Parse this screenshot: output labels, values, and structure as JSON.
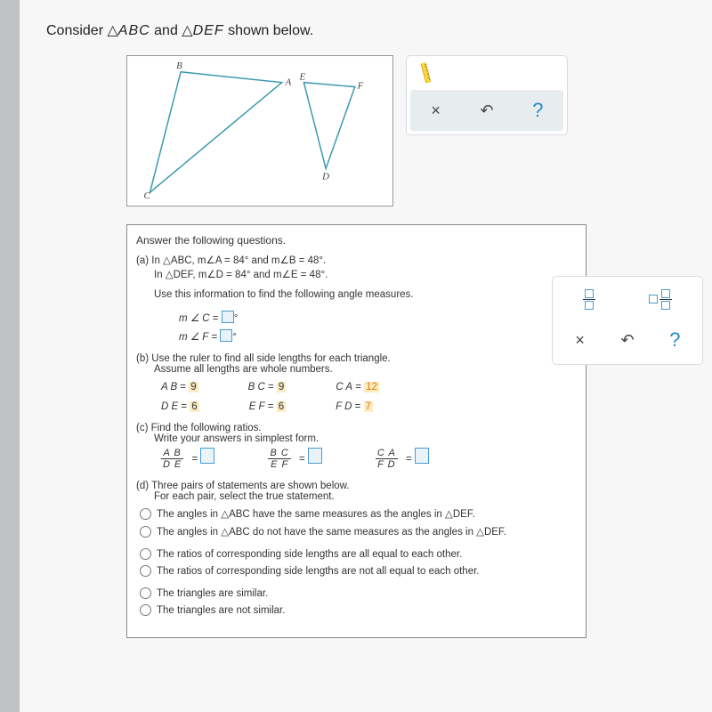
{
  "prompt": {
    "prefix": "Consider ",
    "tri1": "ABC",
    "mid": " and ",
    "tri2": "DEF",
    "suffix": " shown below."
  },
  "answers": {
    "heading": "Answer the following questions.",
    "a": {
      "label": "(a)",
      "line1": " In △ABC, m∠A = 84° and m∠B = 48°.",
      "line2": "In △DEF, m∠D = 84° and m∠E = 48°.",
      "instr": "Use this information to find the following angle measures.",
      "mc": "m ∠ C",
      "mf": "m ∠ F"
    },
    "b": {
      "label": "(b)",
      "text": "Use the ruler to find all side lengths for each triangle.",
      "sub": "Assume all lengths are whole numbers.",
      "ab": {
        "l": "A B",
        "v": "9"
      },
      "bc": {
        "l": "B C",
        "v": "9"
      },
      "ca": {
        "l": "C A",
        "v": "12"
      },
      "de": {
        "l": "D E",
        "v": "6"
      },
      "ef": {
        "l": "E F",
        "v": "6"
      },
      "fd": {
        "l": "F D",
        "v": "7"
      }
    },
    "c": {
      "label": "(c)",
      "text": "Find the following ratios.",
      "sub": "Write your answers in simplest form.",
      "r1": {
        "n": "A B",
        "d": "D E"
      },
      "r2": {
        "n": "B C",
        "d": "E F"
      },
      "r3": {
        "n": "C A",
        "d": "F D"
      }
    },
    "d": {
      "label": "(d)",
      "text": "Three pairs of statements are shown below.",
      "sub": "For each pair, select the true statement.",
      "p1a": "The angles in △ABC have the same measures as the angles in △DEF.",
      "p1b": "The angles in △ABC do not have the same measures as the angles in △DEF.",
      "p2a": "The ratios of corresponding side lengths are all equal to each other.",
      "p2b": "The ratios of corresponding side lengths are not all equal to each other.",
      "p3a": "The triangles are similar.",
      "p3b": "The triangles are not similar."
    }
  }
}
